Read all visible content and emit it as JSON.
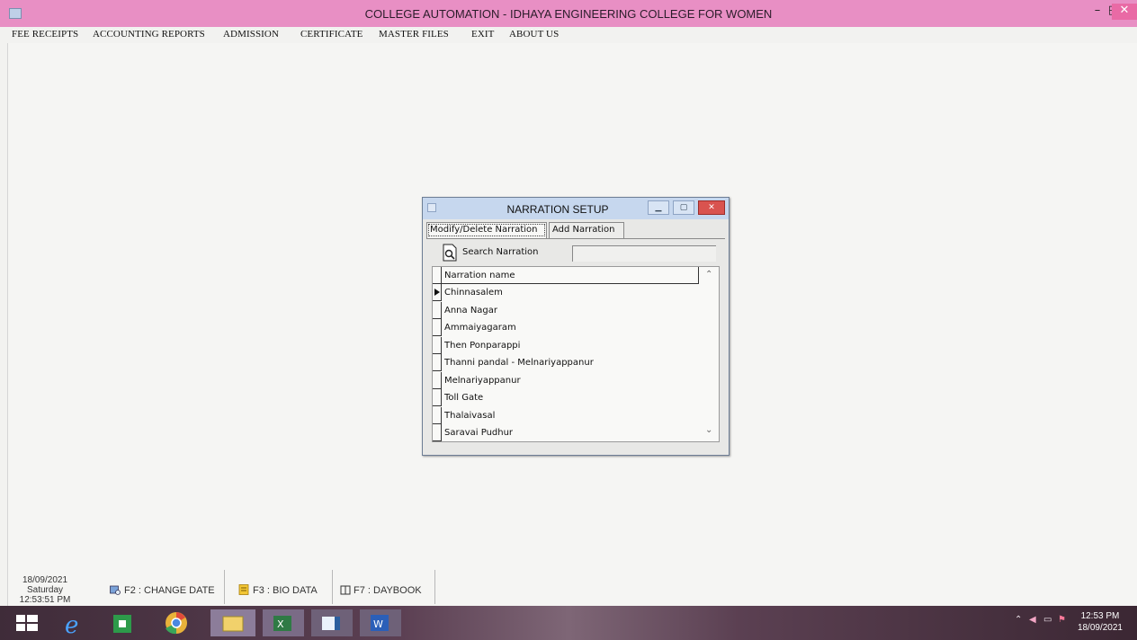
{
  "window": {
    "title": "COLLEGE AUTOMATION - IDHAYA ENGINEERING COLLEGE FOR WOMEN",
    "minimize": "–",
    "maximize": "◰",
    "close": "✕"
  },
  "menu": [
    "FEE RECEIPTS",
    "ACCOUNTING REPORTS",
    "ADMISSION",
    "CERTIFICATE",
    "MASTER FILES",
    "EXIT",
    "ABOUT US"
  ],
  "dialog": {
    "title": "NARRATION SETUP",
    "tabs": [
      "Modify/Delete Narration",
      "Add Narration"
    ],
    "active_tab": 0,
    "search_label": "Search Narration",
    "search_value": "",
    "grid_header": "Narration name",
    "rows": [
      "Chinnasalem",
      "Anna Nagar",
      "Ammaiyagaram",
      "Then Ponparappi",
      "Thanni pandal - Melnariyappanur",
      "Melnariyappanur",
      "Toll Gate",
      "Thalaivasal",
      "Saravai Pudhur"
    ],
    "current_row": 0
  },
  "status": {
    "date": "18/09/2021",
    "day": "Saturday",
    "time": "12:53:51 PM",
    "buttons": [
      "F2 : CHANGE DATE",
      "F3 : BIO DATA",
      "F7 : DAYBOOK"
    ]
  },
  "taskbar": {
    "items": [
      "windows-start",
      "internet-explorer",
      "store",
      "chrome",
      "file-explorer",
      "excel",
      "app-window",
      "word"
    ],
    "clock_time": "12:53 PM",
    "clock_date": "18/09/2021"
  }
}
